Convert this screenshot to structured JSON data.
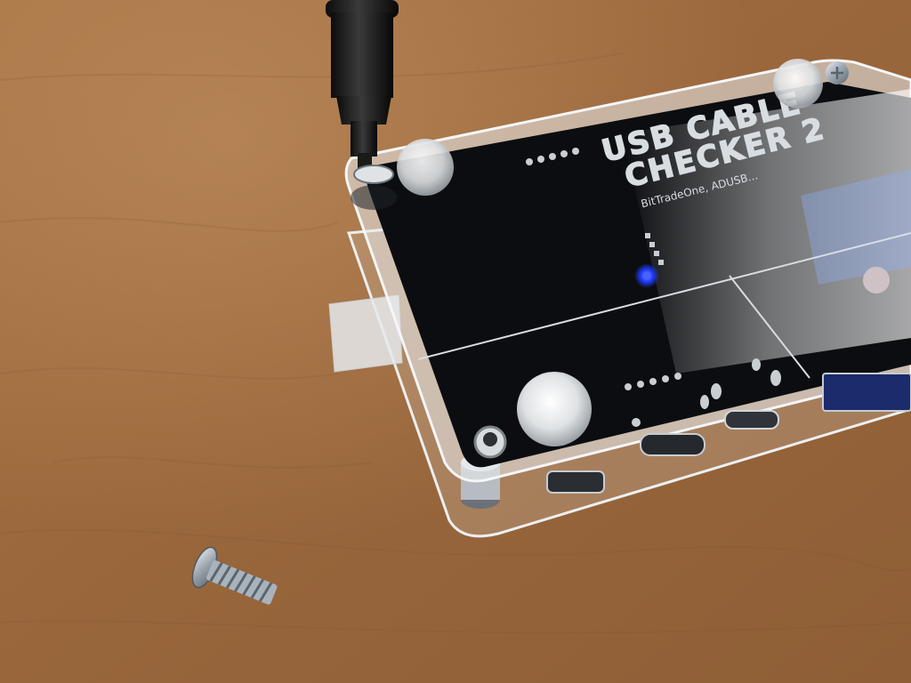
{
  "board": {
    "title_line1": "USB CABLE",
    "title_line2": "CHECKER 2",
    "brand": "BitTradeOne, ADUSB..."
  },
  "colors": {
    "desk": "#9a6a3e",
    "desk_light": "#b0804f",
    "pcb": "#0b0d10",
    "acrylic_edge": "#dfe3e6",
    "led": "#1f3cff",
    "silkscreen": "#d8dde2",
    "tape": "#e6e9ec"
  }
}
